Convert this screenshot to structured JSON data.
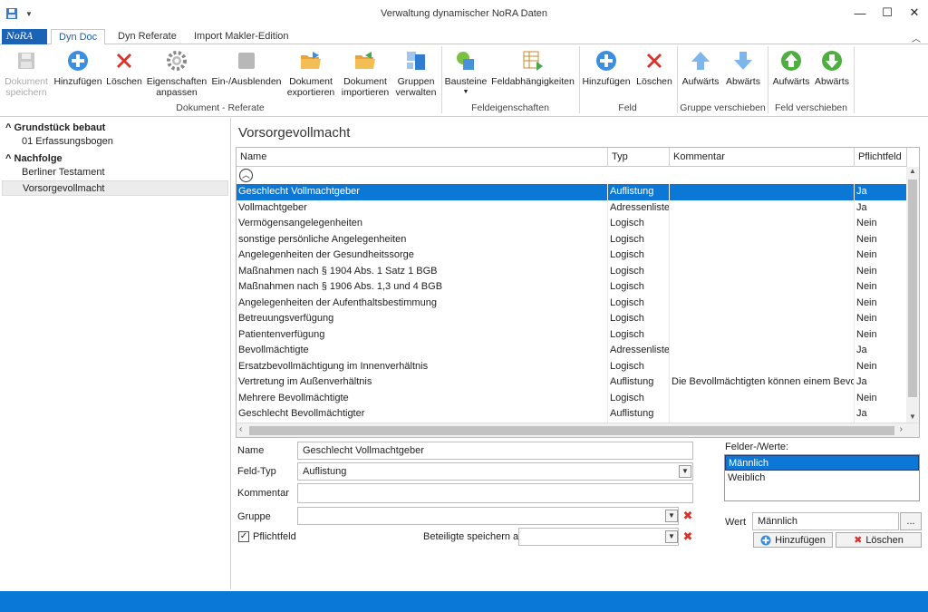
{
  "window": {
    "title": "Verwaltung dynamischer NoRA Daten",
    "controls": [
      "minimize",
      "maximize",
      "close"
    ]
  },
  "ribbon": {
    "tabs": [
      "Dyn Doc",
      "Dyn Referate",
      "Import Makler-Edition"
    ],
    "active_tab": "Dyn Doc",
    "buttons": {
      "save": "Dokument speichern",
      "add": "Hinzufügen",
      "delete": "Löschen",
      "props": "Eigenschaften anpassen",
      "toggle": "Ein-/Ausblenden",
      "export": "Dokument exportieren",
      "import": "Dokument importieren",
      "groups": "Gruppen verwalten",
      "bausteine": "Bausteine",
      "dependencies": "Feldabhängigkeiten",
      "field_add": "Hinzufügen",
      "field_delete": "Löschen",
      "group_up": "Aufwärts",
      "group_down": "Abwärts",
      "field_up": "Aufwärts",
      "field_down": "Abwärts"
    },
    "groups": {
      "doc": "Dokument - Referate",
      "props": "Feldeigenschaften",
      "field": "Feld",
      "group_move": "Gruppe verschieben",
      "field_move": "Feld verschieben"
    }
  },
  "nav": {
    "sections": [
      {
        "label": "Grundstück bebaut",
        "items": [
          "01 Erfassungsbogen"
        ]
      },
      {
        "label": "Nachfolge",
        "items": [
          "Berliner Testament",
          "Vorsorgevollmacht"
        ]
      }
    ],
    "selected": "Vorsorgevollmacht"
  },
  "main": {
    "title": "Vorsorgevollmacht",
    "columns": [
      "Name",
      "Typ",
      "Kommentar",
      "Pflichtfeld"
    ],
    "rows": [
      [
        "Geschlecht Vollmachtgeber",
        "Auflistung",
        "",
        "Ja"
      ],
      [
        "Vollmachtgeber",
        "Adressenliste",
        "",
        "Ja"
      ],
      [
        "Vermögensangelegenheiten",
        "Logisch",
        "",
        "Nein"
      ],
      [
        "sonstige persönliche Angelegenheiten",
        "Logisch",
        "",
        "Nein"
      ],
      [
        "Angelegenheiten der Gesundheitssorge",
        "Logisch",
        "",
        "Nein"
      ],
      [
        "Maßnahmen nach § 1904 Abs. 1 Satz 1 BGB",
        "Logisch",
        "",
        "Nein"
      ],
      [
        "Maßnahmen nach § 1906 Abs. 1,3 und 4 BGB",
        "Logisch",
        "",
        "Nein"
      ],
      [
        "Angelegenheiten der Aufenthaltsbestimmung",
        "Logisch",
        "",
        "Nein"
      ],
      [
        "Betreuungsverfügung",
        "Logisch",
        "",
        "Nein"
      ],
      [
        "Patientenverfügung",
        "Logisch",
        "",
        "Nein"
      ],
      [
        "Bevollmächtigte",
        "Adressenliste",
        "",
        "Ja"
      ],
      [
        "Ersatzbevollmächtigung im Innenverhältnis",
        "Logisch",
        "",
        "Nein"
      ],
      [
        "Vertretung im Außenverhältnis",
        "Auflistung",
        "Die Bevollmächtigten können einem Bevoll",
        "Ja"
      ],
      [
        "Mehrere Bevollmächtigte",
        "Logisch",
        "",
        "Nein"
      ],
      [
        "Geschlecht Bevollmächtigter",
        "Auflistung",
        "",
        "Ja"
      ]
    ],
    "selected_row": 0
  },
  "form": {
    "name_label": "Name",
    "name_value": "Geschlecht Vollmachtgeber",
    "type_label": "Feld-Typ",
    "type_value": "Auflistung",
    "comment_label": "Kommentar",
    "comment_value": "",
    "group_label": "Gruppe",
    "group_value": "",
    "required_label": "Pflichtfeld",
    "required_checked": true,
    "save_as_label": "Beteiligte speichern als",
    "save_as_value": "",
    "values_label": "Felder-/Werte:",
    "values": [
      "Männlich",
      "Weiblich"
    ],
    "selected_value": "Männlich",
    "value_label": "Wert",
    "value_value": "Männlich",
    "browse": "...",
    "add_btn": "Hinzufügen",
    "delete_btn": "Löschen"
  },
  "colors": {
    "accent": "#0b78d7",
    "statusbar": "#0a78d6",
    "delete_red": "#d8332b"
  }
}
